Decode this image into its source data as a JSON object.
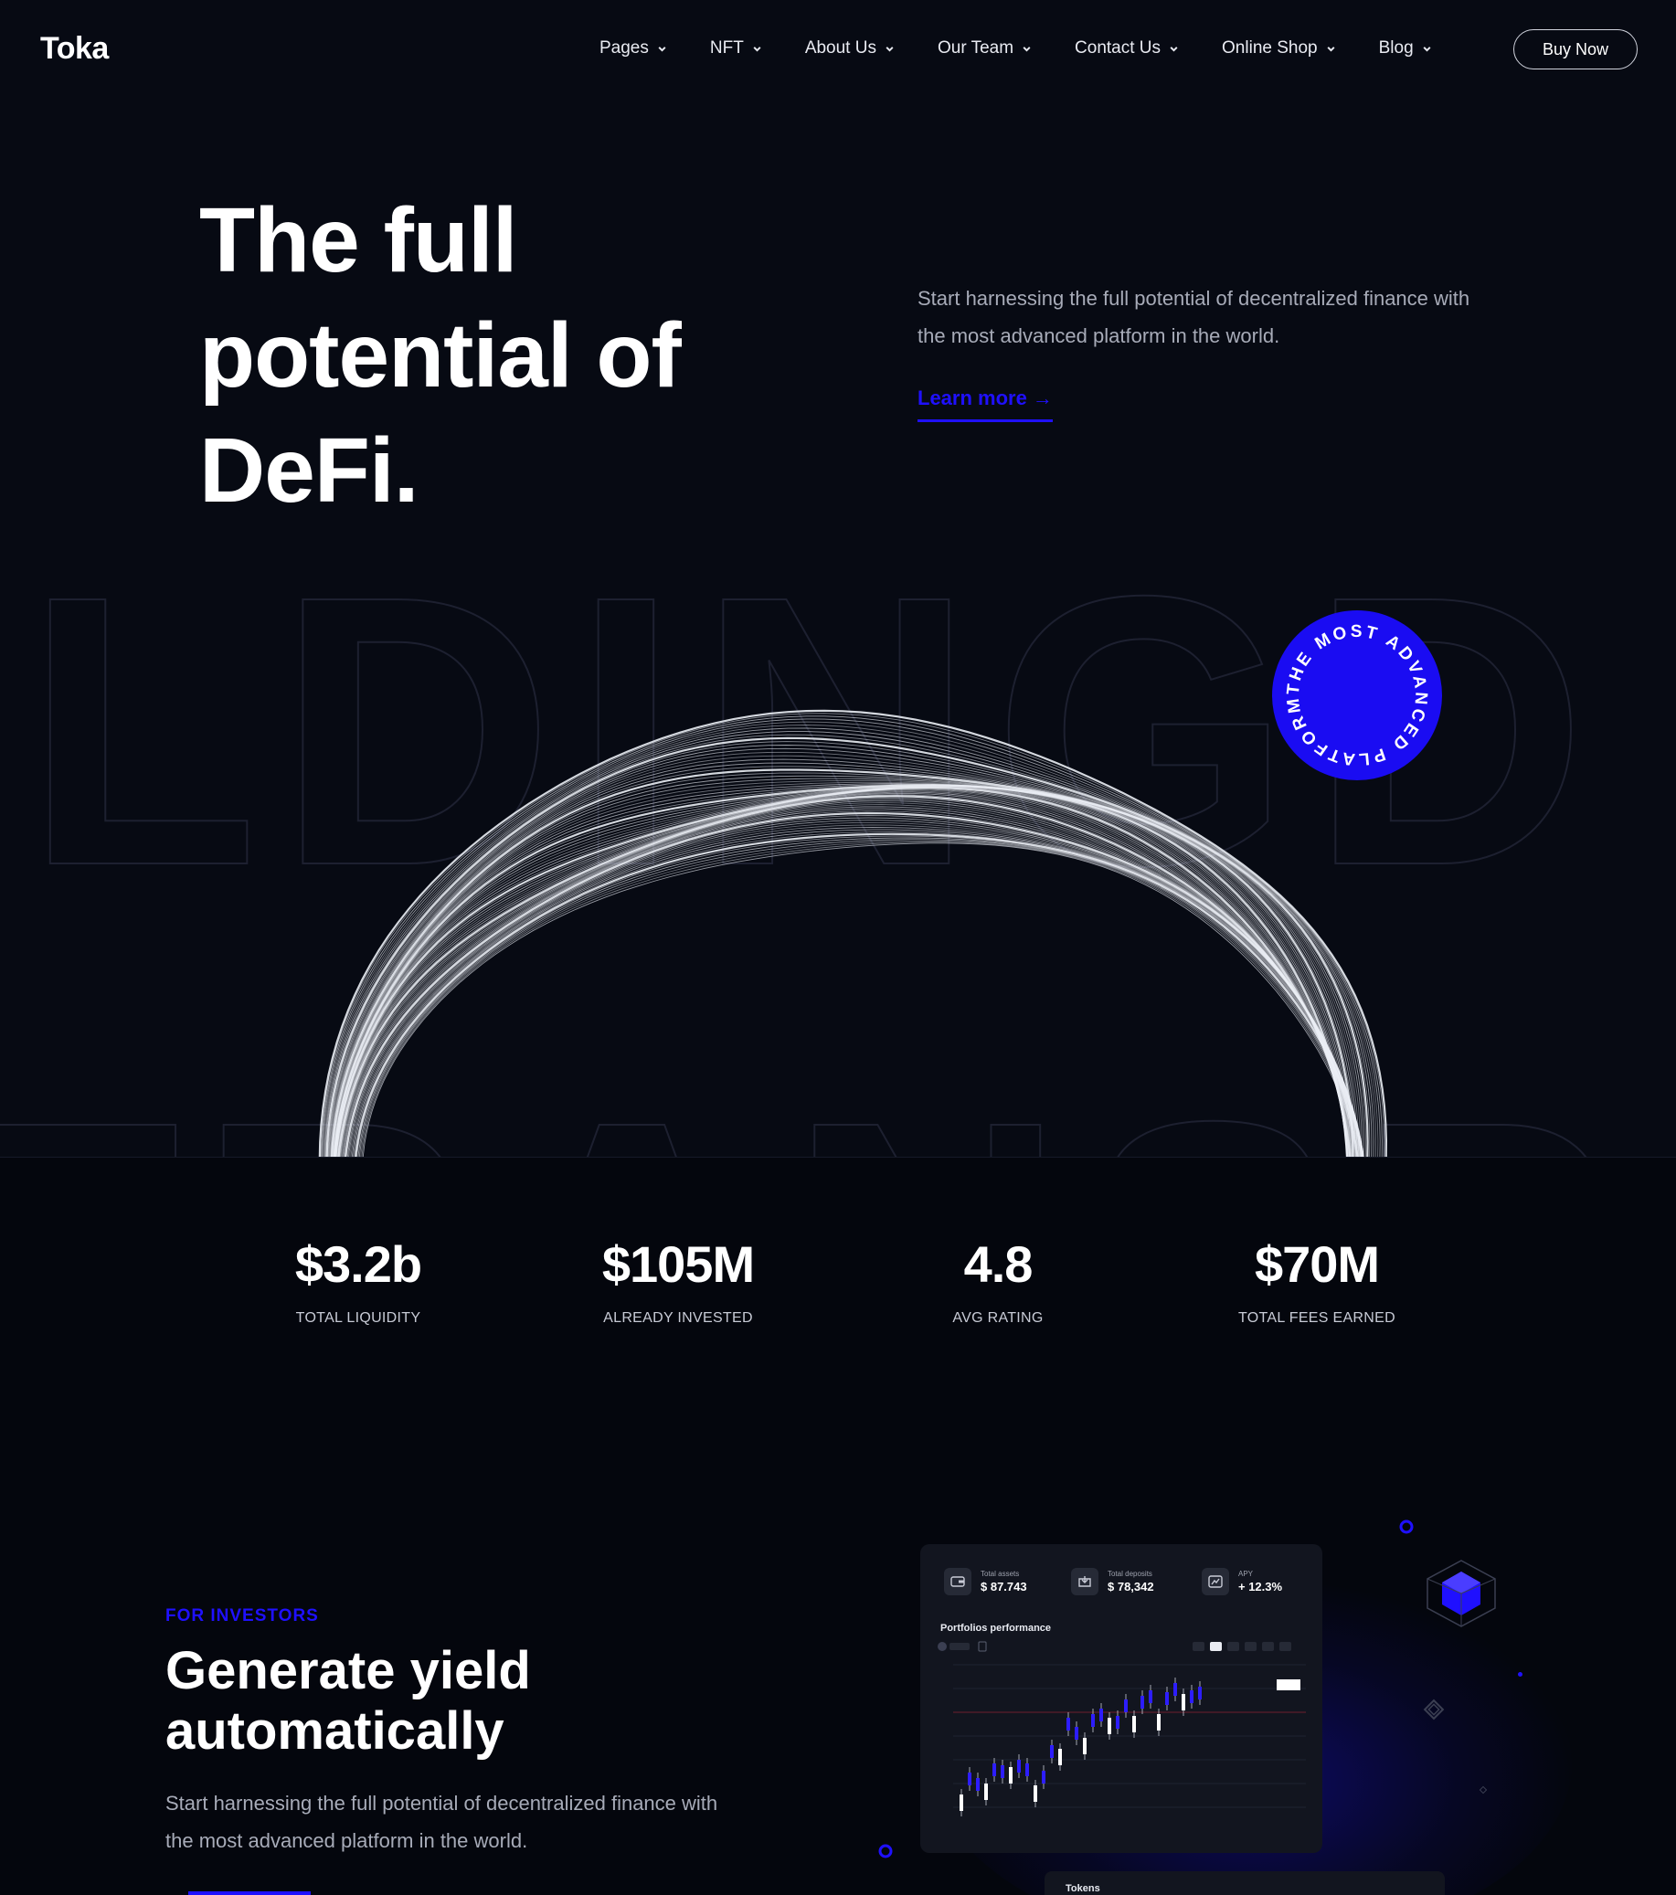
{
  "brand": {
    "logo_text": "Toka"
  },
  "nav": {
    "items": [
      {
        "label": "Pages"
      },
      {
        "label": "NFT"
      },
      {
        "label": "About Us"
      },
      {
        "label": "Our Team"
      },
      {
        "label": "Contact Us"
      },
      {
        "label": "Online Shop"
      },
      {
        "label": "Blog"
      }
    ],
    "cta_label": "Buy Now"
  },
  "hero": {
    "title_lines": [
      "The full",
      "potential of",
      "DeFi."
    ],
    "subtitle": "Start harnessing the full potential of decentralized finance with the most advanced platform in the world.",
    "link_label": "Learn more →",
    "badge_text": "THE MOST ADVANCED PLATFORM •",
    "watermark_text": "ILDINGD"
  },
  "stats": [
    {
      "value": "$3.2b",
      "label": "TOTAL LIQUIDITY"
    },
    {
      "value": "$105M",
      "label": "ALREADY INVESTED"
    },
    {
      "value": "4.8",
      "label": "AVG RATING"
    },
    {
      "value": "$70M",
      "label": "TOTAL FEES EARNED"
    }
  ],
  "investors": {
    "eyebrow": "FOR INVESTORS",
    "title_lines": [
      "Generate yield",
      "automatically"
    ],
    "subtitle": "Start harnessing the full potential of decentralized finance with the most advanced platform in the world."
  },
  "dashboard": {
    "cards": [
      {
        "label": "Total assets",
        "value": "$ 87.743"
      },
      {
        "label": "Total deposits",
        "value": "$ 78,342"
      },
      {
        "label": "APY",
        "value": "+ 12.3%"
      }
    ],
    "chart_title": "Portfolios performance",
    "tokens_label": "Tokens"
  },
  "colors": {
    "accent": "#1f10ff",
    "background": "#070a13",
    "text_muted": "#a7abb8"
  }
}
